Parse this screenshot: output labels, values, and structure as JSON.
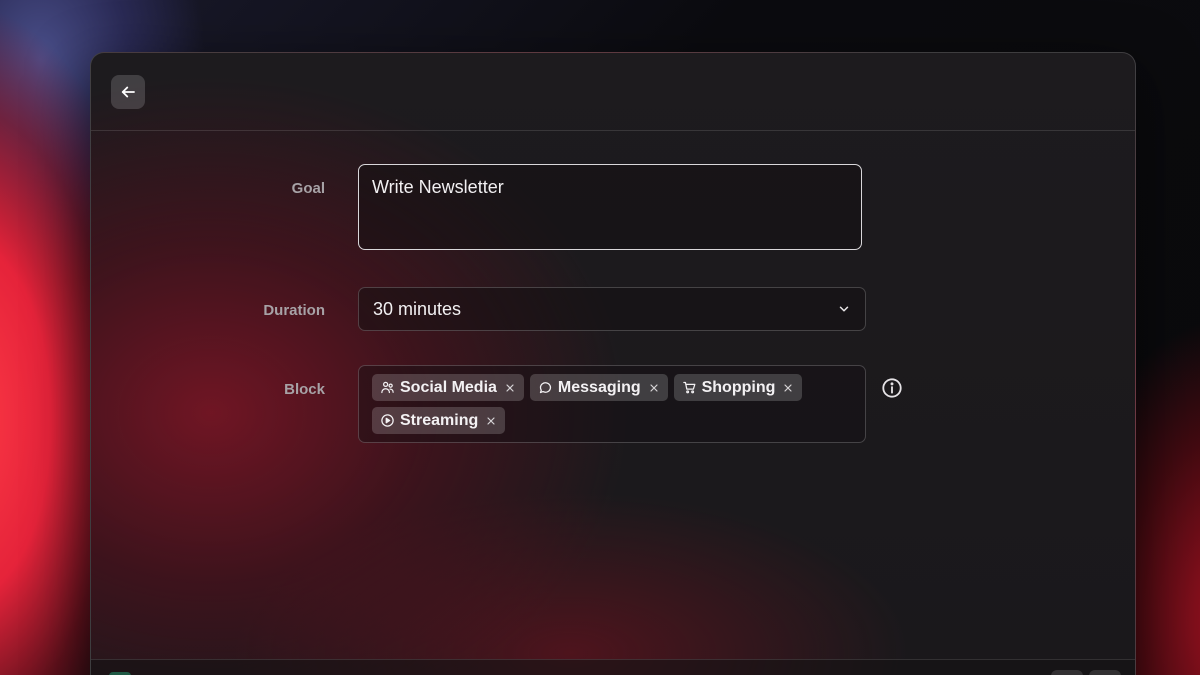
{
  "form": {
    "goal": {
      "label": "Goal",
      "value": "Write Newsletter"
    },
    "duration": {
      "label": "Duration",
      "value": "30 minutes"
    },
    "block": {
      "label": "Block",
      "chips": [
        {
          "label": "Social Media",
          "icon": "people-icon"
        },
        {
          "label": "Messaging",
          "icon": "chat-bubble-icon"
        },
        {
          "label": "Shopping",
          "icon": "cart-icon"
        },
        {
          "label": "Streaming",
          "icon": "play-circle-icon"
        }
      ]
    }
  },
  "colors": {
    "accent_red": "#e5233a",
    "panel": "#1b191c",
    "text": "#f2f0f2",
    "label": "#a7a2a6"
  }
}
